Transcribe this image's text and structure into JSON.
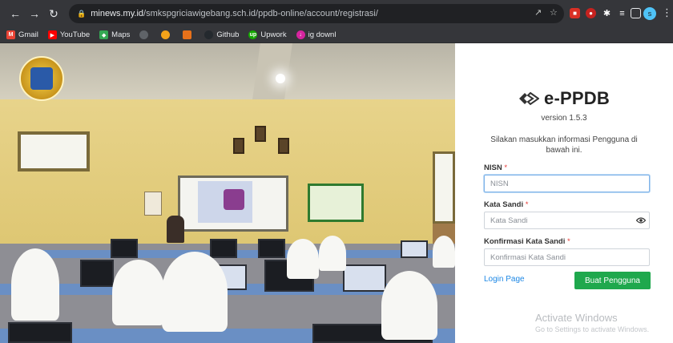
{
  "browser": {
    "url_host": "minews.my.id",
    "url_path": "/smkspgriciawigebang.sch.id/ppdb-online/account/registrasi/",
    "bookmarks": [
      {
        "label": "Gmail",
        "icon": "gmail-icon",
        "color": "#ea4335"
      },
      {
        "label": "YouTube",
        "icon": "youtube-icon",
        "color": "#ff0000"
      },
      {
        "label": "Maps",
        "icon": "maps-icon",
        "color": "#34a853"
      },
      {
        "label": "",
        "icon": "bookmark-icon-1",
        "color": "#5f6368"
      },
      {
        "label": "",
        "icon": "bookmark-icon-2",
        "color": "#f4a31a"
      },
      {
        "label": "",
        "icon": "bookmark-icon-3",
        "color": "#e8711a"
      },
      {
        "label": "Github",
        "icon": "github-icon",
        "color": "#24292e"
      },
      {
        "label": "Upwork",
        "icon": "upwork-icon",
        "color": "#14a800"
      },
      {
        "label": "ig downl",
        "icon": "ig-download-icon",
        "color": "#d6249f"
      }
    ],
    "profile_initial": "s"
  },
  "app": {
    "title": "e-PPDB",
    "version": "version 1.5.3",
    "info": "Silakan masukkan informasi Pengguna di bawah ini.",
    "accent_color": "#1fa84d"
  },
  "form": {
    "nisn_label": "NISN",
    "nisn_placeholder": "NISN",
    "password_label": "Kata Sandi",
    "password_placeholder": "Kata Sandi",
    "confirm_label": "Konfirmasi Kata Sandi",
    "confirm_placeholder": "Konfirmasi Kata Sandi",
    "required_mark": "*",
    "login_link": "Login Page",
    "submit_label": "Buat Pengguna"
  },
  "watermark": {
    "title": "Activate Windows",
    "subtitle": "Go to Settings to activate Windows."
  }
}
